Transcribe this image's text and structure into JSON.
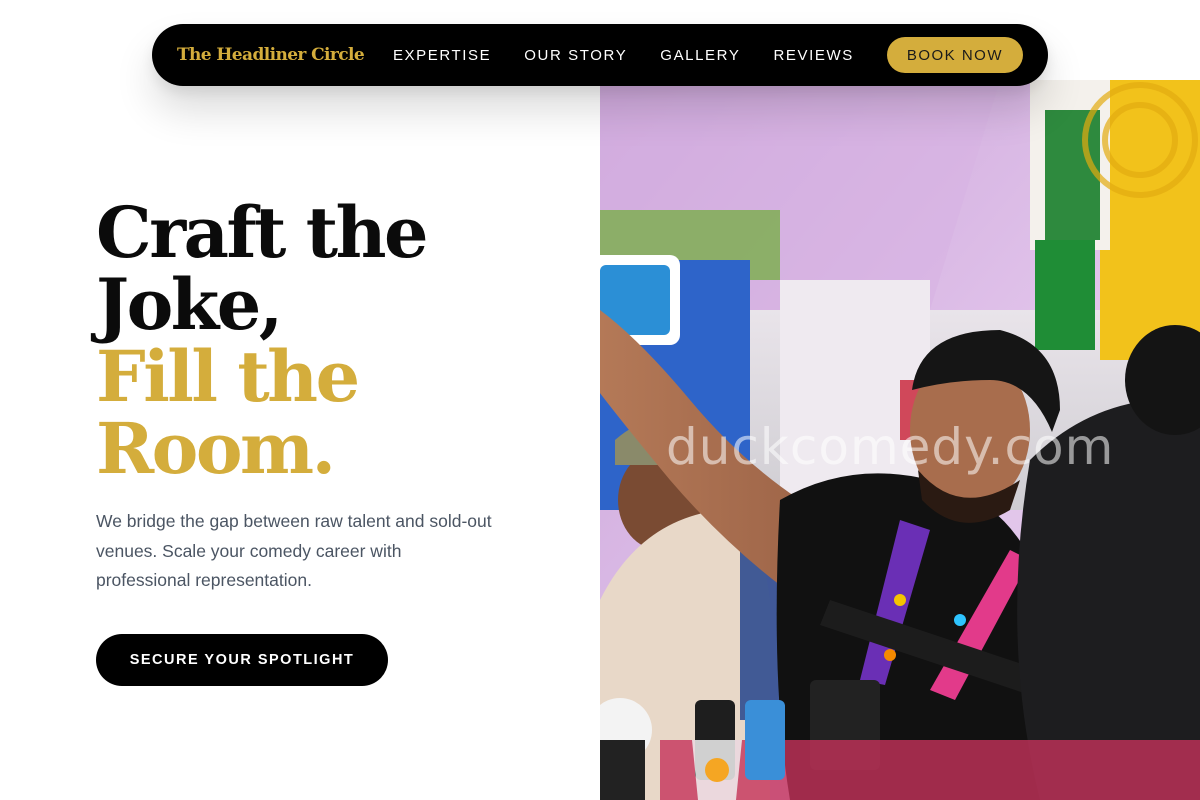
{
  "nav": {
    "brand": "The Headliner Circle",
    "links": [
      {
        "label": "EXPERTISE"
      },
      {
        "label": "OUR STORY"
      },
      {
        "label": "GALLERY"
      },
      {
        "label": "REVIEWS"
      }
    ],
    "cta_label": "BOOK NOW"
  },
  "hero": {
    "title_lines": [
      "Craft the",
      "Joke,",
      "Fill the",
      "Room."
    ],
    "subtitle": "We bridge the gap between raw talent and sold-out venues. Scale your comedy career with professional representation.",
    "cta_label": "SECURE YOUR SPOTLIGHT"
  },
  "photo": {
    "watermark": "duckcomedy.com"
  },
  "colors": {
    "accent_gold": "#d4ad3c",
    "nav_bg": "#000000",
    "text_dark": "#0b0b0b",
    "text_muted": "#4b5563"
  }
}
